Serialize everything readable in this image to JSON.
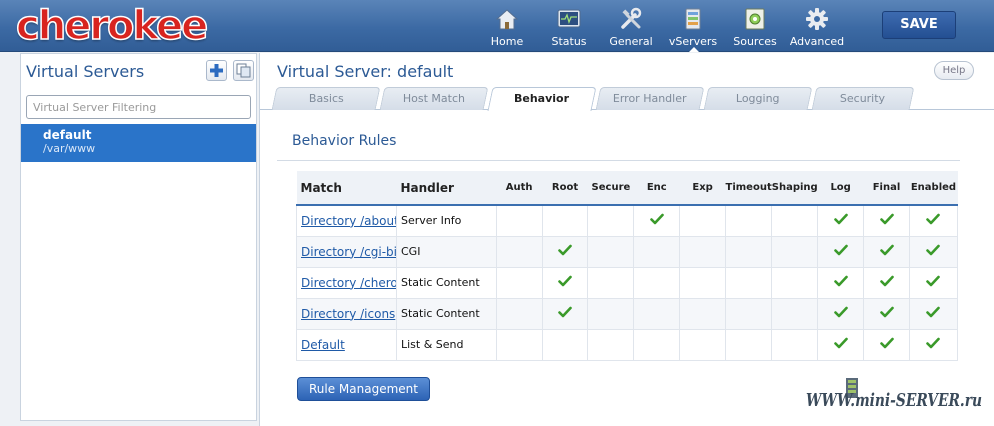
{
  "app": {
    "logo_text": "cherokee"
  },
  "nav": [
    {
      "label": "Home",
      "icon": "home-icon"
    },
    {
      "label": "Status",
      "icon": "status-monitor-icon"
    },
    {
      "label": "General",
      "icon": "tools-icon"
    },
    {
      "label": "vServers",
      "icon": "vservers-icon"
    },
    {
      "label": "Sources",
      "icon": "sources-icon"
    },
    {
      "label": "Advanced",
      "icon": "gear-icon"
    }
  ],
  "save_label": "SAVE",
  "sidebar": {
    "title": "Virtual Servers",
    "filter_placeholder": "Virtual Server Filtering",
    "servers": [
      {
        "name": "default",
        "path": "/var/www"
      }
    ]
  },
  "main": {
    "title": "Virtual Server: default",
    "help_label": "Help",
    "tabs": [
      "Basics",
      "Host Match",
      "Behavior",
      "Error Handler",
      "Logging",
      "Security"
    ],
    "active_tab": "Behavior",
    "section_title": "Behavior Rules",
    "columns": [
      "Match",
      "Handler",
      "Auth",
      "Root",
      "Secure",
      "Enc",
      "Exp",
      "Timeout",
      "Shaping",
      "Log",
      "Final",
      "Enabled"
    ],
    "rows": [
      {
        "match": "Directory /about",
        "handler": "Server Info",
        "flags": [
          false,
          false,
          false,
          true,
          false,
          false,
          false,
          true,
          true,
          true
        ]
      },
      {
        "match": "Directory /cgi-bin",
        "handler": "CGI",
        "flags": [
          false,
          true,
          false,
          false,
          false,
          false,
          false,
          true,
          true,
          true
        ]
      },
      {
        "match": "Directory /cherokee_themes",
        "handler": "Static Content",
        "flags": [
          false,
          true,
          false,
          false,
          false,
          false,
          false,
          true,
          true,
          true
        ]
      },
      {
        "match": "Directory /icons",
        "handler": "Static Content",
        "flags": [
          false,
          true,
          false,
          false,
          false,
          false,
          false,
          true,
          true,
          true
        ]
      },
      {
        "match": "Default",
        "handler": "List & Send",
        "flags": [
          false,
          false,
          false,
          false,
          false,
          false,
          false,
          true,
          true,
          true
        ]
      }
    ],
    "rule_button": "Rule Management"
  },
  "watermark": {
    "text": "WWW.mini-SERVER.ru"
  },
  "colors": {
    "accent": "#2a74c9",
    "check": "#3a9a2a",
    "logo_red": "#d8241f"
  }
}
